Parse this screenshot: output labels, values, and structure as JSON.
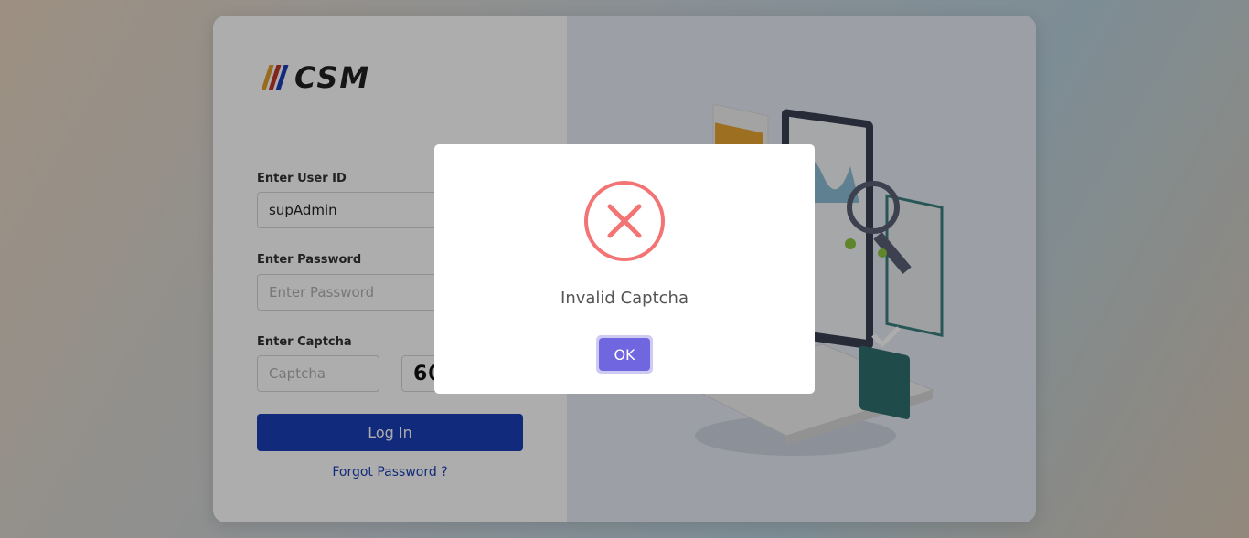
{
  "login": {
    "logo_text": "CSM",
    "user_id_label": "Enter User ID",
    "user_id_value": "supAdmin",
    "password_label": "Enter Password",
    "password_placeholder": "Enter Password",
    "captcha_label": "Enter Captcha",
    "captcha_placeholder": "Captcha",
    "captcha_code": "60",
    "login_button": "Log In",
    "forgot_link": "Forgot Password ?"
  },
  "modal": {
    "icon": "error-x-icon",
    "message": "Invalid Captcha",
    "ok_label": "OK"
  },
  "colors": {
    "primary": "#1b3fb5",
    "modal_button": "#7066e0",
    "error": "#f27474"
  }
}
